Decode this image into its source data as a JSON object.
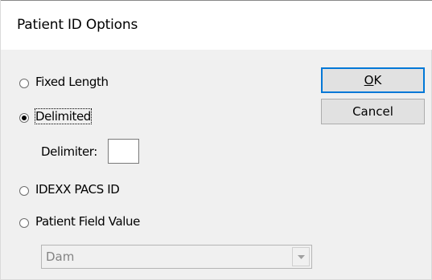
{
  "window": {
    "title": "Patient ID Options"
  },
  "options": {
    "fixed_length": {
      "label": "Fixed Length",
      "selected": false
    },
    "delimited": {
      "label": "Delimited",
      "selected": true
    },
    "idexx_pacs_id": {
      "label": "IDEXX PACS ID",
      "selected": false
    },
    "patient_field_value": {
      "label": "Patient Field Value",
      "selected": false
    }
  },
  "delimiter": {
    "label": "Delimiter:",
    "value": ""
  },
  "field_select": {
    "value": "Dam",
    "disabled": true
  },
  "buttons": {
    "ok_label": "OK",
    "ok_mnemonic": "O",
    "ok_rest": "K",
    "cancel_label": "Cancel"
  },
  "colors": {
    "accent": "#0078d7",
    "background": "#f0f0f0",
    "disabled_text": "#838383"
  }
}
